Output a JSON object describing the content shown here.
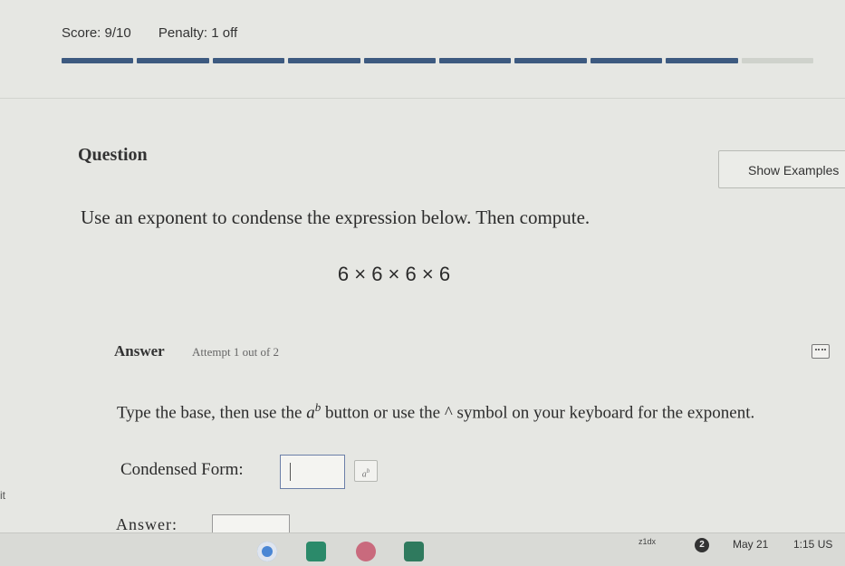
{
  "header": {
    "score": "Score: 9/10",
    "penalty": "Penalty: 1 off"
  },
  "progress": {
    "segments_total": 10,
    "segments_filled": 9
  },
  "question": {
    "heading": "Question",
    "show_examples_label": "Show Examples",
    "prompt": "Use an exponent to condense the expression below. Then compute.",
    "expression": "6 × 6 × 6 × 6"
  },
  "answer": {
    "heading": "Answer",
    "attempt": "Attempt 1 out of 2",
    "instruction_part1": "Type the base, then use the ",
    "instruction_a": "a",
    "instruction_b": "b",
    "instruction_part2": " button or use the ^ symbol on your keyboard for the exponent.",
    "condensed_label": "Condensed Form:",
    "condensed_value": "",
    "exponent_button_base": "a",
    "exponent_button_exp": "b",
    "answer_label": "Answer:",
    "answer_value": ""
  },
  "edge_text": "it",
  "taskbar": {
    "apps": [
      "chrome-icon",
      "meet-icon",
      "game-icon",
      "files-icon"
    ],
    "tray_text": "z1dx",
    "notification_count": "2",
    "date": "May 21",
    "time": "1:15 US"
  },
  "colors": {
    "progress_fill": "#3d5a80",
    "background": "#e6e7e3"
  }
}
